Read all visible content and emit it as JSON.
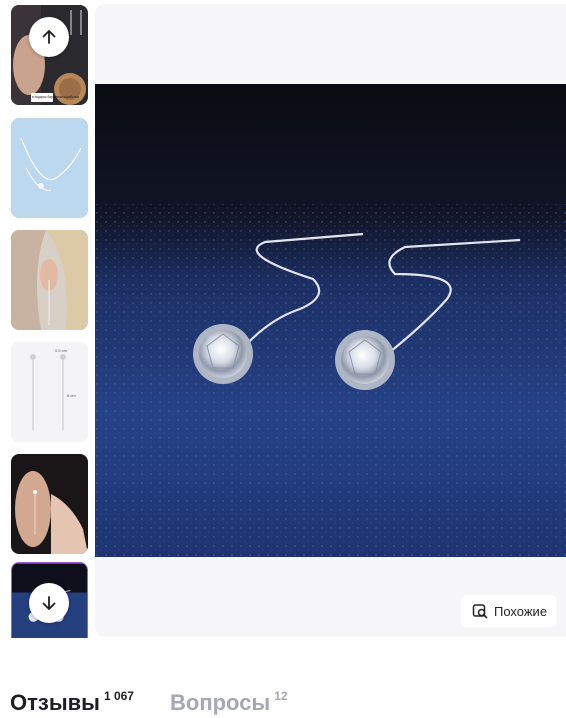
{
  "gallery": {
    "thumbnails": [
      {
        "name": "model-with-earring-and-gift-box",
        "selected": false,
        "caption": "в подарок бархатная коробочка"
      },
      {
        "name": "earring-chain-on-light-blue",
        "selected": false
      },
      {
        "name": "earring-worn-on-ear",
        "selected": false
      },
      {
        "name": "earring-size-chart",
        "selected": false,
        "size_top": "0.5 cm",
        "size_length": "8 cm"
      },
      {
        "name": "earring-worn-with-hand",
        "selected": false
      },
      {
        "name": "earrings-on-dark-blue",
        "selected": true
      }
    ],
    "scroll_up_icon": "arrow-up-icon",
    "scroll_down_icon": "arrow-down-icon"
  },
  "main_image": {
    "description_key": "moissanite-thread-earrings",
    "background_color": "#1e3a78"
  },
  "similar_button": {
    "label": "Похожие",
    "icon": "image-search-icon"
  },
  "tabs": [
    {
      "label": "Отзывы",
      "count": "1 067",
      "active": true
    },
    {
      "label": "Вопросы",
      "count": "12",
      "active": false
    }
  ],
  "colors": {
    "accent": "#a05ad8",
    "card_bg": "#f6f6f9",
    "inactive_tab": "#a6a7b6"
  }
}
